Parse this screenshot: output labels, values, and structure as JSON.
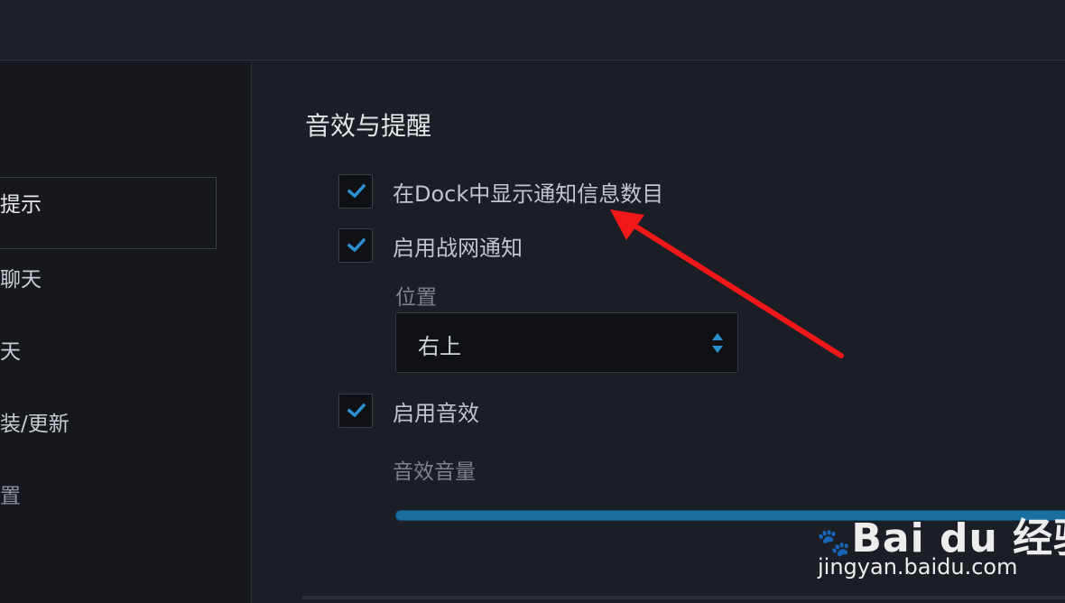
{
  "sidebar": {
    "items": [
      {
        "label": "提示",
        "active": true
      },
      {
        "label": "聊天"
      },
      {
        "label": "天"
      },
      {
        "label": "装/更新"
      },
      {
        "label": "置"
      }
    ]
  },
  "main": {
    "section_title": "音效与提醒",
    "options": {
      "dock_badge": {
        "label": "在Dock中显示通知信息数目",
        "checked": true
      },
      "battlenet_notify": {
        "label": "启用战网通知",
        "checked": true
      },
      "sound": {
        "label": "启用音效",
        "checked": true
      }
    },
    "position": {
      "label": "位置",
      "value": "右上"
    },
    "volume": {
      "label": "音效音量",
      "level": 1.0
    }
  },
  "colors": {
    "accent": "#1a6fa0",
    "check": "#2d8fd0",
    "arrow": "#f01818"
  },
  "watermark": {
    "logo": "Bai  du 经验",
    "url": "jingyan.baidu.com"
  }
}
